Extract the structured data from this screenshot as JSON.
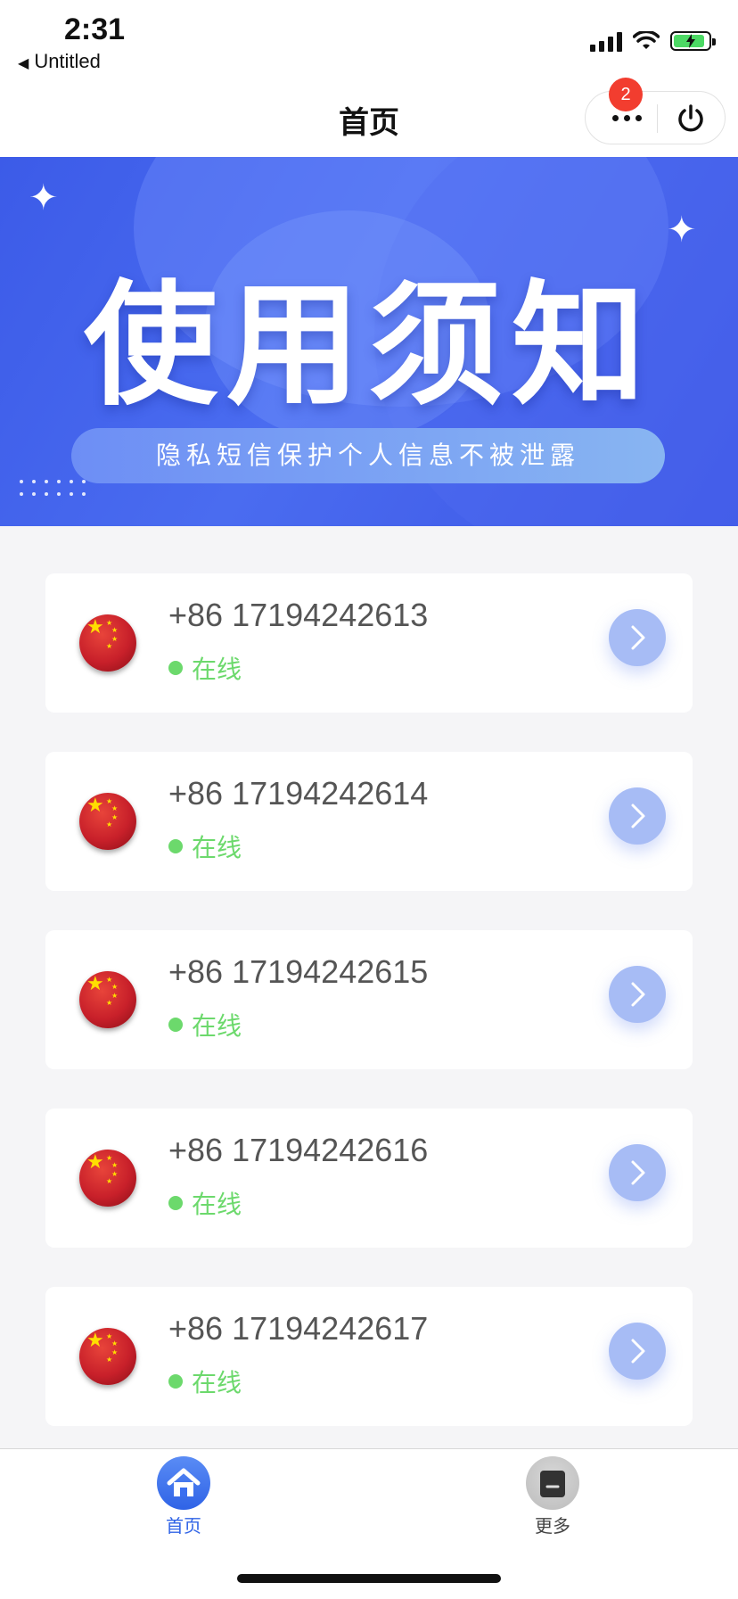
{
  "status_bar": {
    "time": "2:31",
    "back_app": "Untitled"
  },
  "nav": {
    "title": "首页",
    "badge_count": "2"
  },
  "banner": {
    "title": "使用须知",
    "subtitle": "隐私短信保护个人信息不被泄露"
  },
  "numbers": [
    {
      "phone": "+86 17194242613",
      "status": "在线"
    },
    {
      "phone": "+86 17194242614",
      "status": "在线"
    },
    {
      "phone": "+86 17194242615",
      "status": "在线"
    },
    {
      "phone": "+86 17194242616",
      "status": "在线"
    },
    {
      "phone": "+86 17194242617",
      "status": "在线"
    }
  ],
  "tabs": [
    {
      "label": "首页",
      "icon": "home-icon",
      "active": true
    },
    {
      "label": "更多",
      "icon": "more-icon",
      "active": false
    }
  ],
  "colors": {
    "accent": "#3c5be8",
    "online": "#6cd96c",
    "badge": "#f23d2f",
    "tab_active": "#2f63e6",
    "tab_inactive": "#444444"
  }
}
